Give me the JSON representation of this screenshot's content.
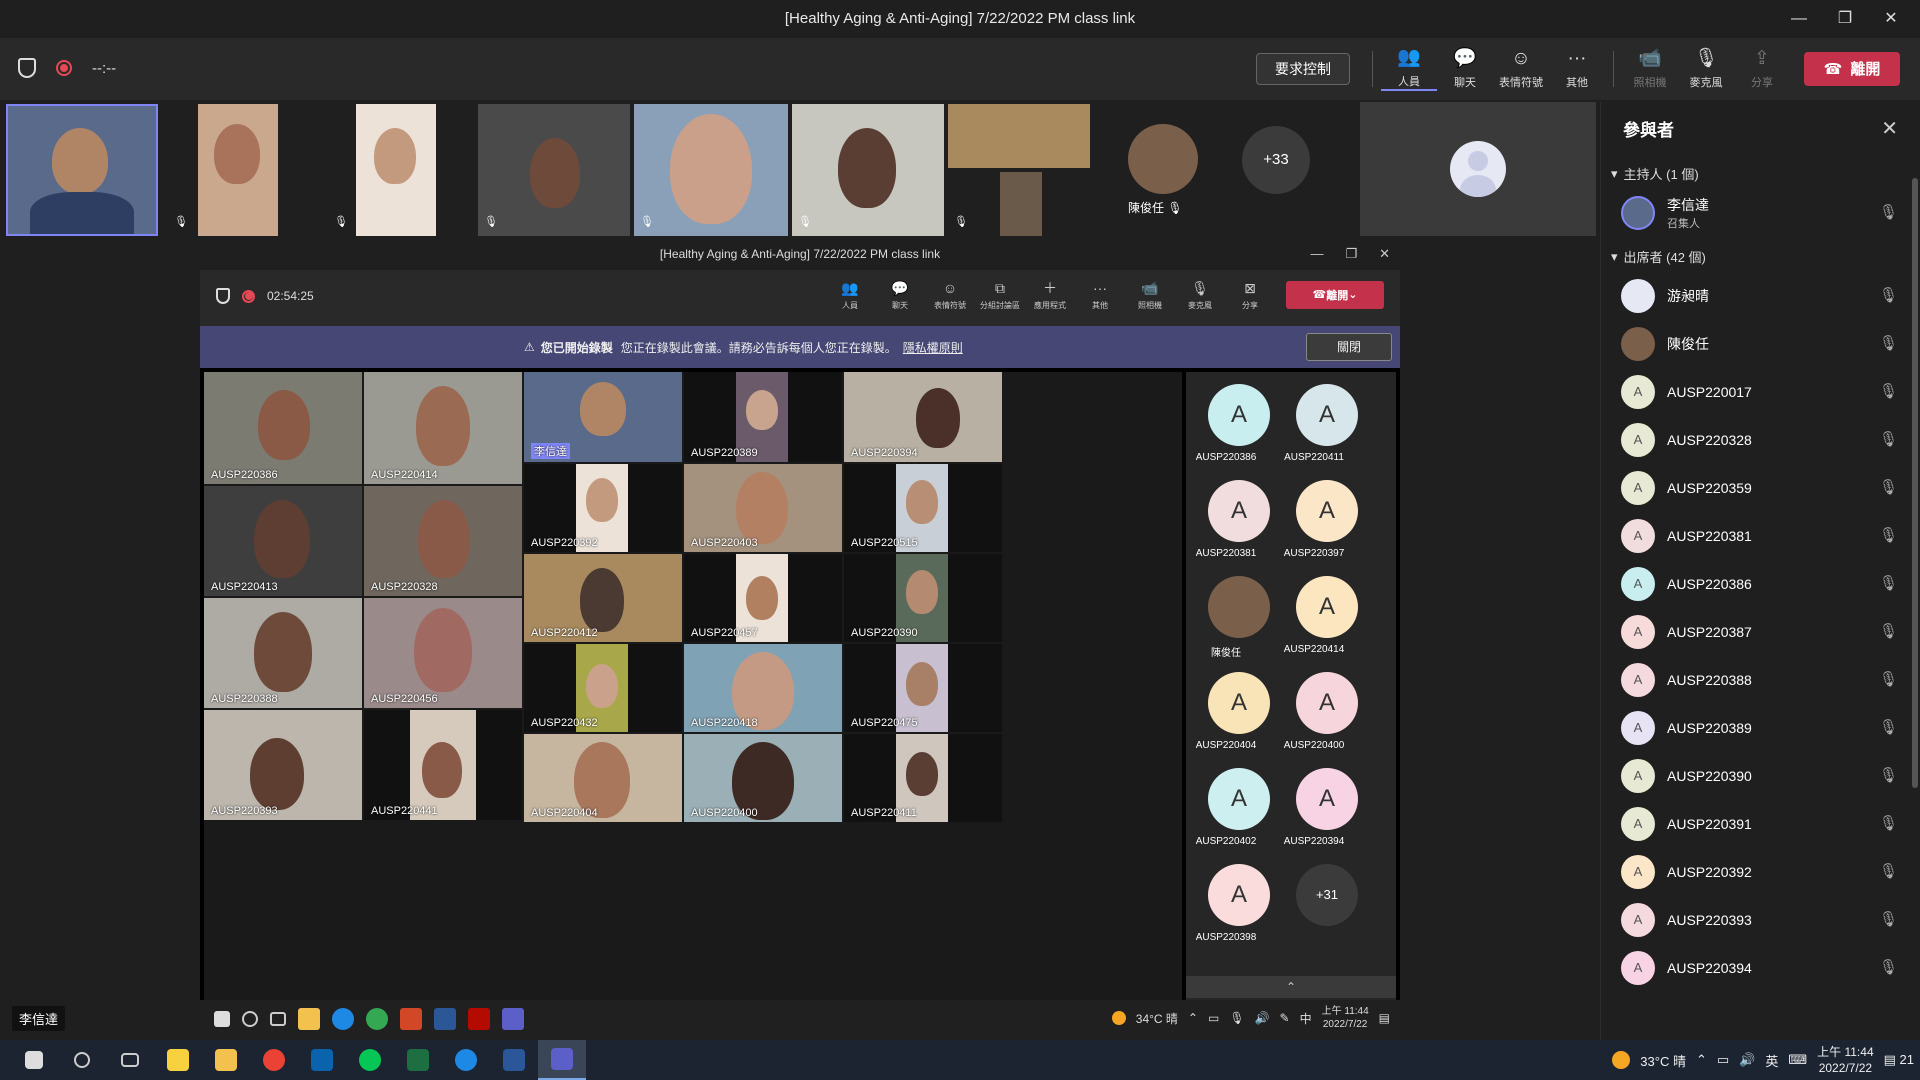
{
  "window": {
    "title": "[Healthy Aging & Anti-Aging] 7/22/2022 PM class link",
    "controls": [
      "—",
      "❐",
      "✕"
    ]
  },
  "toolbar": {
    "timer": "--:--",
    "request_control": "要求控制",
    "buttons": [
      {
        "label": "人員",
        "icon": "people-icon",
        "glyph": "👥"
      },
      {
        "label": "聊天",
        "icon": "chat-icon",
        "glyph": "💬"
      },
      {
        "label": "表情符號",
        "icon": "emoji-icon",
        "glyph": "☺"
      },
      {
        "label": "其他",
        "icon": "more-icon",
        "glyph": "···"
      }
    ],
    "disabled_buttons": [
      {
        "label": "照相機",
        "glyph": "📹"
      },
      {
        "label": "麥克風",
        "glyph": "🎙"
      },
      {
        "label": "分享",
        "glyph": "⇪"
      }
    ],
    "leave": "離開"
  },
  "strip": {
    "avatar_name": "陳俊任",
    "more_count": "+33"
  },
  "inner": {
    "title": "[Healthy Aging & Anti-Aging] 7/22/2022 PM class link",
    "timer": "02:54:25",
    "buttons": [
      "人員",
      "聊天",
      "表情符號",
      "分組討論區",
      "應用程式",
      "其他"
    ],
    "media_buttons": [
      "照相機",
      "麥克風",
      "分享"
    ],
    "leave": "離開",
    "banner": {
      "bold": "您已開始錄製",
      "text": "您正在錄製此會議。請務必告訴每個人您正在錄製。",
      "link": "隱私權原則",
      "close": "關閉"
    },
    "tiles": [
      {
        "label": "AUSP220386"
      },
      {
        "label": "AUSP220414"
      },
      {
        "label": "李信達"
      },
      {
        "label": "AUSP220389"
      },
      {
        "label": "AUSP220394"
      },
      {
        "label": "AUSP220413"
      },
      {
        "label": "AUSP220328"
      },
      {
        "label": "AUSP220392"
      },
      {
        "label": "AUSP220403"
      },
      {
        "label": "AUSP220515"
      },
      {
        "label": "AUSP220412"
      },
      {
        "label": "AUSP220457"
      },
      {
        "label": "AUSP220390"
      },
      {
        "label": "AUSP220388"
      },
      {
        "label": "AUSP220456"
      },
      {
        "label": "AUSP220432"
      },
      {
        "label": "AUSP220418"
      },
      {
        "label": "AUSP220475"
      },
      {
        "label": "AUSP220393"
      },
      {
        "label": "AUSP220441"
      },
      {
        "label": "AUSP220404"
      },
      {
        "label": "AUSP220400"
      },
      {
        "label": "AUSP220411"
      }
    ],
    "side_avatars": [
      {
        "label": "AUSP220386",
        "letter": "A",
        "color": "#c8eef0"
      },
      {
        "label": "AUSP220411",
        "letter": "A",
        "color": "#d6e6ea"
      },
      {
        "label": "AUSP220381",
        "letter": "A",
        "color": "#f1dddd"
      },
      {
        "label": "AUSP220397",
        "letter": "A",
        "color": "#fbe6c8"
      },
      {
        "label": "陳俊任",
        "letter": "",
        "color": "#7a5f4a"
      },
      {
        "label": "AUSP220414",
        "letter": "A",
        "color": "#fbe6c0"
      },
      {
        "label": "AUSP220404",
        "letter": "A",
        "color": "#f9e4b8"
      },
      {
        "label": "AUSP220400",
        "letter": "A",
        "color": "#f6d6dc"
      },
      {
        "label": "AUSP220402",
        "letter": "A",
        "color": "#cdeff0"
      },
      {
        "label": "AUSP220394",
        "letter": "A",
        "color": "#f8d3e4"
      },
      {
        "label": "AUSP220398",
        "letter": "A",
        "color": "#fbdcdc"
      }
    ],
    "side_more": "+31",
    "taskbar": {
      "weather": "34°C 晴",
      "ime": "中",
      "time": "上午 11:44",
      "date": "2022/7/22"
    }
  },
  "panel": {
    "title": "參與者",
    "organizers_header": "主持人 (1 個)",
    "attendees_header": "出席者 (42 個)",
    "organizer": {
      "name": "李信達",
      "role": "召集人"
    },
    "attendees": [
      {
        "name": "游昶晴",
        "color": "#e6e8f4",
        "letter": ""
      },
      {
        "name": "陳俊任",
        "color": "#7a5f4a",
        "letter": ""
      },
      {
        "name": "AUSP220017",
        "color": "#e7e9d4",
        "letter": "A"
      },
      {
        "name": "AUSP220328",
        "color": "#e7e9d4",
        "letter": "A"
      },
      {
        "name": "AUSP220359",
        "color": "#e7e9d4",
        "letter": "A"
      },
      {
        "name": "AUSP220381",
        "color": "#f1dddd",
        "letter": "A"
      },
      {
        "name": "AUSP220386",
        "color": "#c8eef0",
        "letter": "A"
      },
      {
        "name": "AUSP220387",
        "color": "#f7dada",
        "letter": "A"
      },
      {
        "name": "AUSP220388",
        "color": "#f4d9df",
        "letter": "A"
      },
      {
        "name": "AUSP220389",
        "color": "#e7e3f4",
        "letter": "A"
      },
      {
        "name": "AUSP220390",
        "color": "#e7e9d4",
        "letter": "A"
      },
      {
        "name": "AUSP220391",
        "color": "#e7e9d4",
        "letter": "A"
      },
      {
        "name": "AUSP220392",
        "color": "#fbe6c8",
        "letter": "A"
      },
      {
        "name": "AUSP220393",
        "color": "#f4d9df",
        "letter": "A"
      },
      {
        "name": "AUSP220394",
        "color": "#f8d3e4",
        "letter": "A"
      }
    ]
  },
  "self_name": "李信達",
  "taskbar": {
    "weather": "33°C 晴",
    "ime": "英",
    "time": "上午 11:44",
    "date": "2022/7/22",
    "notifications": "21"
  }
}
